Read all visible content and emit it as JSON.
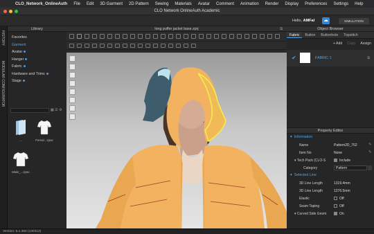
{
  "menubar": {
    "items": [
      "CLO_Network_OnlineAuth",
      "File",
      "Edit",
      "3D Garment",
      "2D Pattern",
      "Sewing",
      "Materials",
      "Avatar",
      "Comment",
      "Animation",
      "Render",
      "Display",
      "Preferences",
      "Settings",
      "Help"
    ]
  },
  "window": {
    "title": "CLO Network OnlineAuth Academic"
  },
  "apptop": {
    "hello": "Hello,",
    "user": "AMFal",
    "simulation": "SIMULATION"
  },
  "side_strip": {
    "history": "HISTORY",
    "modular": "MODULAR CONFIGURATOR"
  },
  "library": {
    "title": "Library",
    "items": [
      {
        "label": "Favorites",
        "active": false
      },
      {
        "label": "Garment",
        "active": true
      },
      {
        "label": "Avatar",
        "active": false
      },
      {
        "label": "Hanger",
        "active": false
      },
      {
        "label": "Fabric",
        "active": false
      },
      {
        "label": "Hardware and Trims",
        "active": false
      },
      {
        "label": "Stage",
        "active": false
      }
    ],
    "thumbs": [
      {
        "label": "..."
      },
      {
        "label": "Femal...zpac"
      },
      {
        "label": "Male_...zpac"
      }
    ]
  },
  "view": {
    "title": "long puffer jacket base.zprj"
  },
  "object_browser": {
    "title": "Object Browser",
    "tabs": [
      "Fabric",
      "Button",
      "Buttonhole",
      "Topstitch"
    ],
    "actions": {
      "add": "+ Add",
      "copy": "Copy",
      "assign": "Assign"
    },
    "fabric_name": "FABRIC 1"
  },
  "property_editor": {
    "title": "Property Editor",
    "info_section": "Information",
    "name_label": "Name",
    "name_value": "Pattern2D_762",
    "item_no_label": "Item No",
    "item_no_value": "None",
    "tech_pack_label": "Tech Pack (CLO-S",
    "tech_pack_value": "Include",
    "category_label": "Category",
    "category_value": "Pattern",
    "selected_line_section": "Selected Line",
    "line3d_label": "3D Line Length",
    "line3d_value": "1319.4mm",
    "line3d2_label": "3D Line Length",
    "line3d2_value": "1276.5mm",
    "elastic_label": "Elastic",
    "elastic_value": "Off",
    "seam_label": "Seam Taping",
    "seam_value": "Off",
    "curved_label": "Curved Side Geom",
    "curved_value": "On"
  },
  "status": {
    "version": "Version: 5.1.382 (130312)"
  },
  "colors": {
    "accent": "#4aa7f0",
    "jacket": "#f2b25f",
    "hood_other": "#3d5d6c"
  }
}
